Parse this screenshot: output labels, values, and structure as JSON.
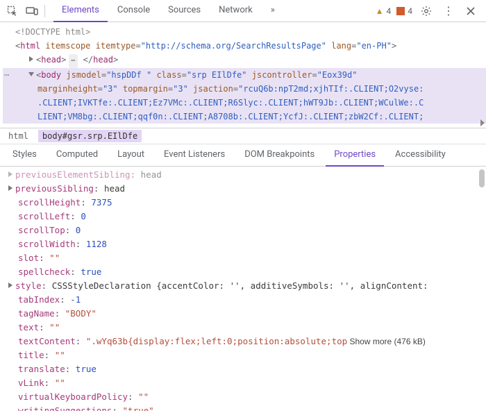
{
  "toolbar": {
    "panel_tabs": [
      "Elements",
      "Console",
      "Sources",
      "Network"
    ],
    "active_panel_tab": "Elements",
    "overflow_glyph": "»",
    "warnings_count": "4",
    "errors_count": "4"
  },
  "dom": {
    "doctype": "<!DOCTYPE html>",
    "html_open": {
      "tag": "html",
      "attrs": [
        {
          "n": "itemscope",
          "v": ""
        },
        {
          "n": "itemtype",
          "v": "\"http://schema.org/SearchResultsPage\""
        },
        {
          "n": "lang",
          "v": "\"en-PH\""
        }
      ]
    },
    "head": {
      "open": "<head>",
      "close": "</head>"
    },
    "body_open": {
      "tag": "body",
      "attrs_line1": "jsmodel=\"hspDDf \" class=\"srp EIlDfe\" jscontroller=\"Eox39d\"",
      "attrs_line2": "marginheight=\"3\" topmargin=\"3\" jsaction=\"rcuQ6b:npT2md;xjhTIf:.CLIENT;O2vyse:",
      "attrs_line3": ".CLIENT;IVKTfe:.CLIENT;Ez7VMc:.CLIENT;R6Slyc:.CLIENT;hWT9Jb:.CLIENT;WCulWe:.C",
      "attrs_line4": "LIENT;VM8bg:.CLIENT;qqf0n:.CLIENT;A8708b:.CLIENT;YcfJ:.CLIENT;zbW2Cf:.CLIENT;"
    }
  },
  "breadcrumb": {
    "items": [
      "html",
      "body#gsr.srp.EIlDfe"
    ]
  },
  "subtabs": {
    "items": [
      "Styles",
      "Computed",
      "Layout",
      "Event Listeners",
      "DOM Breakpoints",
      "Properties",
      "Accessibility"
    ],
    "active": "Properties"
  },
  "properties": [
    {
      "name": "previousElementSibling",
      "sep": ": ",
      "value": "head",
      "type": "obj",
      "has_toggle": true,
      "dim": true
    },
    {
      "name": "previousSibling",
      "sep": ": ",
      "value": "head",
      "type": "obj",
      "has_toggle": true
    },
    {
      "name": "scrollHeight",
      "sep": ": ",
      "value": "7375",
      "type": "num"
    },
    {
      "name": "scrollLeft",
      "sep": ": ",
      "value": "0",
      "type": "num"
    },
    {
      "name": "scrollTop",
      "sep": ": ",
      "value": "0",
      "type": "num"
    },
    {
      "name": "scrollWidth",
      "sep": ": ",
      "value": "1128",
      "type": "num"
    },
    {
      "name": "slot",
      "sep": ": ",
      "value": "\"\"",
      "type": "str"
    },
    {
      "name": "spellcheck",
      "sep": ": ",
      "value": "true",
      "type": "bool"
    },
    {
      "name": "style",
      "sep": ": ",
      "value": "CSSStyleDeclaration {accentColor: '', additiveSymbols: '', alignContent:",
      "type": "obj",
      "has_toggle": true
    },
    {
      "name": "tabIndex",
      "sep": ": ",
      "value": "-1",
      "type": "num"
    },
    {
      "name": "tagName",
      "sep": ": ",
      "value": "\"BODY\"",
      "type": "str"
    },
    {
      "name": "text",
      "sep": ": ",
      "value": "\"\"",
      "type": "str"
    },
    {
      "name": "textContent",
      "sep": ": ",
      "value": "\".wYq63b{display:flex;left:0;position:absolute;top",
      "type": "str",
      "show_more": "Show more (476 kB)"
    },
    {
      "name": "title",
      "sep": ": ",
      "value": "\"\"",
      "type": "str"
    },
    {
      "name": "translate",
      "sep": ": ",
      "value": "true",
      "type": "bool"
    },
    {
      "name": "vLink",
      "sep": ": ",
      "value": "\"\"",
      "type": "str"
    },
    {
      "name": "virtualKeyboardPolicy",
      "sep": ": ",
      "value": "\"\"",
      "type": "str"
    },
    {
      "name": "writingSuggestions",
      "sep": ": ",
      "value": "\"true\"",
      "type": "str"
    }
  ]
}
